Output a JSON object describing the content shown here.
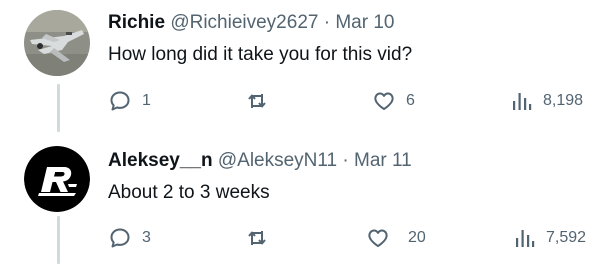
{
  "replies": [
    {
      "display_name": "Richie",
      "handle": "@Richieivey2627",
      "separator": "·",
      "date": "Mar 10",
      "text": "How long did it take you for this vid?",
      "reply_count": "1",
      "retweet_count": "",
      "like_count": "6",
      "view_count": "8,198",
      "avatar_icon": "drone-photo-avatar"
    },
    {
      "display_name": "Aleksey__n",
      "handle": "@AlekseyN11",
      "separator": "·",
      "date": "Mar 11",
      "text": "About 2 to 3 weeks",
      "reply_count": "3",
      "retweet_count": "",
      "like_count": "20",
      "view_count": "7,592",
      "avatar_icon": "r-logo-avatar"
    }
  ],
  "icons": {
    "reply": "speech-bubble-icon",
    "retweet": "retweet-icon",
    "like": "heart-icon",
    "views": "bar-chart-icon"
  },
  "colors": {
    "text_primary": "#0f1419",
    "text_secondary": "#536471",
    "thread_line": "#cfd9de"
  }
}
